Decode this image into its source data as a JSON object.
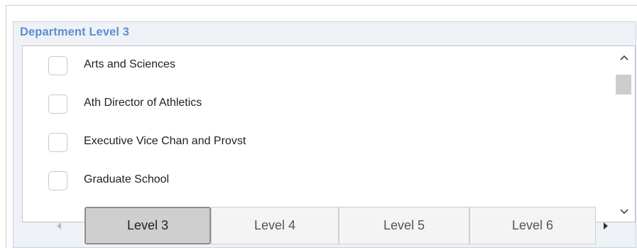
{
  "panel": {
    "title": "Department Level 3"
  },
  "list": {
    "items": [
      {
        "label": "Arts and Sciences",
        "checked": false
      },
      {
        "label": "Ath Director of Athletics",
        "checked": false
      },
      {
        "label": "Executive Vice Chan and Provst",
        "checked": false
      },
      {
        "label": "Graduate School",
        "checked": false
      }
    ]
  },
  "tabs": {
    "items": [
      {
        "label": "Level 3",
        "active": true
      },
      {
        "label": "Level 4",
        "active": false
      },
      {
        "label": "Level 5",
        "active": false
      },
      {
        "label": "Level 6",
        "active": false
      }
    ]
  },
  "icons": {
    "scroll_up": "chevron-up-icon",
    "scroll_down": "chevron-down-icon",
    "tab_prev": "triangle-left-icon",
    "tab_next": "triangle-right-icon"
  },
  "colors": {
    "title": "#5b8fd1",
    "panel_bg": "#eef2f7",
    "active_tab_bg": "#cfcfcf",
    "active_tab_border": "#8e8e8e"
  }
}
